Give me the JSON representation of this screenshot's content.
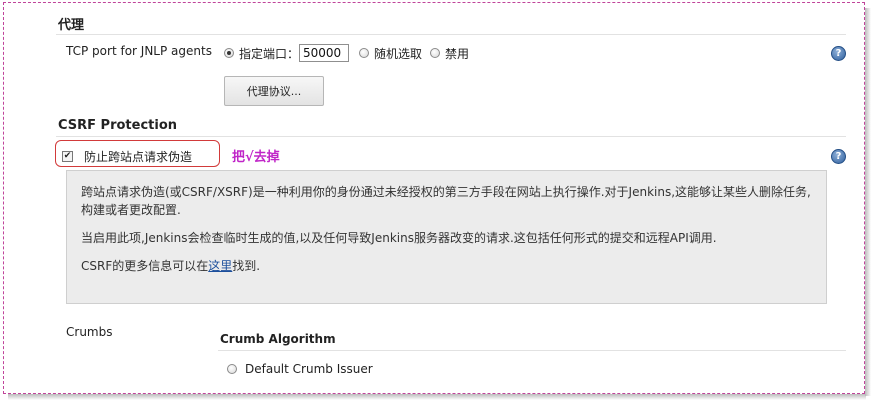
{
  "agent": {
    "section_title": "代理",
    "port_label": "TCP port for JNLP agents",
    "options": {
      "fixed_label": "指定端口：",
      "fixed_value": "50000",
      "random_label": "随机选取",
      "disable_label": "禁用"
    },
    "selected_option": "fixed",
    "protocols_button": "代理协议..."
  },
  "csrf": {
    "section_title": "CSRF Protection",
    "checkbox_label": "防止跨站点请求伪造",
    "checked": true,
    "annotation": "把√去掉",
    "description": {
      "p1": "跨站点请求伪造(或CSRF/XSRF)是一种利用你的身份通过未经授权的第三方手段在网站上执行操作.对于Jenkins,这能够让某些人删除任务,构建或者更改配置.",
      "p2": "当启用此项,Jenkins会检查临时生成的值,以及任何导致Jenkins服务器改变的请求.这包括任何形式的提交和远程API调用.",
      "p3_before": "CSRF的更多信息可以在",
      "p3_link": "这里",
      "p3_after": "找到."
    }
  },
  "crumbs": {
    "label": "Crumbs",
    "algorithm_title": "Crumb Algorithm",
    "issuer_option": "Default Crumb Issuer"
  },
  "help_icon": "?",
  "colors": {
    "annotation": "#c026c8",
    "callout_border": "#d23a3a",
    "frame_border": "#c0449a"
  }
}
